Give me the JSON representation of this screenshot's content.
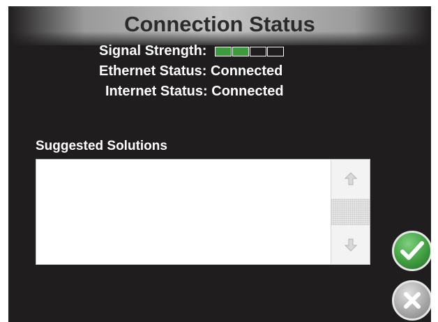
{
  "dialog": {
    "title": "Connection Status",
    "signal": {
      "label": "Signal Strength:",
      "bars_total": 4,
      "bars_filled": 2,
      "filled_color": "#3d9b3d"
    },
    "ethernet": {
      "label": "Ethernet Status:",
      "value": "Connected"
    },
    "internet": {
      "label": "Internet Status:",
      "value": "Connected"
    }
  },
  "solutions": {
    "label": "Suggested Solutions",
    "items": []
  },
  "icons": {
    "scroll_up": "arrow-up-icon",
    "scroll_down": "arrow-down-icon",
    "confirm": "checkmark-icon",
    "cancel": "x-icon"
  },
  "colors": {
    "background": "#1f1d1d",
    "confirm": "#3f9e3f",
    "cancel": "#a9a9a9"
  }
}
